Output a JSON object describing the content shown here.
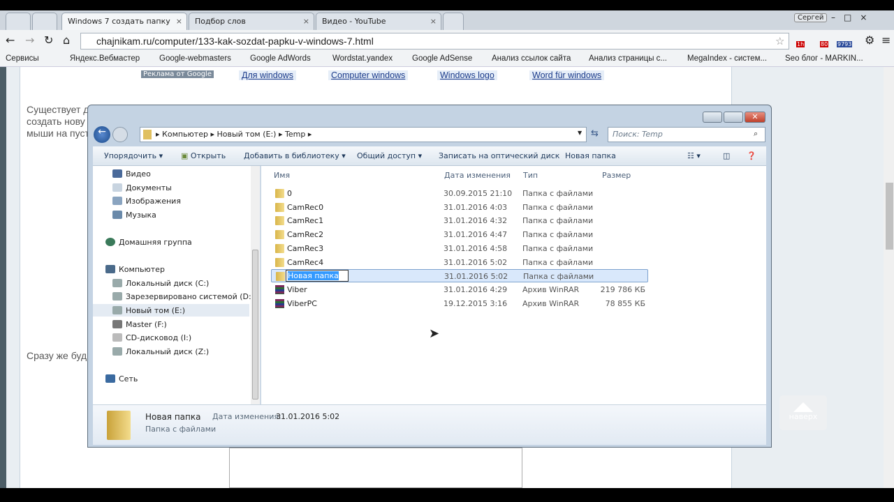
{
  "browser": {
    "tabs": [
      {
        "label": "Windows 7 создать папку",
        "active": true
      },
      {
        "label": "Подбор слов"
      },
      {
        "label": "Видео - YouTube"
      }
    ],
    "user": "Сергей",
    "url": "chajnikam.ru/computer/133-kak-sozdat-papku-v-windows-7.html",
    "bookmarks": [
      "Сервисы",
      "Яндекс.Вебмастер",
      "Google-webmasters",
      "Google AdWords",
      "Wordstat.yandex",
      "Google AdSense",
      "Анализ ссылок сайта",
      "Анализ страницы с...",
      "MegaIndex - систем...",
      "Seo блог - MARKIN..."
    ],
    "ext_badges": [
      "1h",
      "80",
      "9793"
    ]
  },
  "page": {
    "ads_label": "Реклама от Google",
    "ads": [
      "Для windows",
      "Computer windows",
      "Windows logo",
      "Word für windows"
    ],
    "text1": "Существует д",
    "text2": "создать нову",
    "text3": "мыши на пуст",
    "text4": "Сразу же буд",
    "up_button": "наверх"
  },
  "explorer": {
    "breadcrumb": [
      "Компьютер",
      "Новый том (E:)",
      "Temp"
    ],
    "search_placeholder": "Поиск: Temp",
    "toolbar": [
      "Упорядочить",
      "Открыть",
      "Добавить в библиотеку",
      "Общий доступ",
      "Записать на оптический диск",
      "Новая папка"
    ],
    "nav": [
      {
        "label": "Видео"
      },
      {
        "label": "Документы"
      },
      {
        "label": "Изображения"
      },
      {
        "label": "Музыка"
      },
      {
        "label": "Домашняя группа"
      },
      {
        "label": "Компьютер"
      },
      {
        "label": "Локальный диск (C:)"
      },
      {
        "label": "Зарезервировано системой (D:)"
      },
      {
        "label": "Новый том (E:)",
        "selected": true
      },
      {
        "label": "Master (F:)"
      },
      {
        "label": "CD-дисковод (I:)"
      },
      {
        "label": "Локальный диск (Z:)"
      },
      {
        "label": "Сеть"
      }
    ],
    "columns": [
      "Имя",
      "Дата изменения",
      "Тип",
      "Размер"
    ],
    "files": [
      {
        "name": "0",
        "date": "30.09.2015 21:10",
        "type": "Папка с файлами",
        "size": ""
      },
      {
        "name": "CamRec0",
        "date": "31.01.2016 4:03",
        "type": "Папка с файлами",
        "size": ""
      },
      {
        "name": "CamRec1",
        "date": "31.01.2016 4:32",
        "type": "Папка с файлами",
        "size": ""
      },
      {
        "name": "CamRec2",
        "date": "31.01.2016 4:47",
        "type": "Папка с файлами",
        "size": ""
      },
      {
        "name": "CamRec3",
        "date": "31.01.2016 4:58",
        "type": "Папка с файлами",
        "size": ""
      },
      {
        "name": "CamRec4",
        "date": "31.01.2016 5:02",
        "type": "Папка с файлами",
        "size": ""
      },
      {
        "name": "Новая папка",
        "date": "31.01.2016 5:02",
        "type": "Папка с файлами",
        "size": "",
        "renaming": true
      },
      {
        "name": "Viber",
        "date": "31.01.2016 4:29",
        "type": "Архив WinRAR",
        "size": "219 786 КБ"
      },
      {
        "name": "ViberPC",
        "date": "19.12.2015 3:16",
        "type": "Архив WinRAR",
        "size": "78 855 КБ"
      }
    ],
    "details": {
      "name": "Новая папка",
      "date_label": "Дата изменения:",
      "date": "31.01.2016 5:02",
      "type": "Папка с файлами"
    }
  }
}
